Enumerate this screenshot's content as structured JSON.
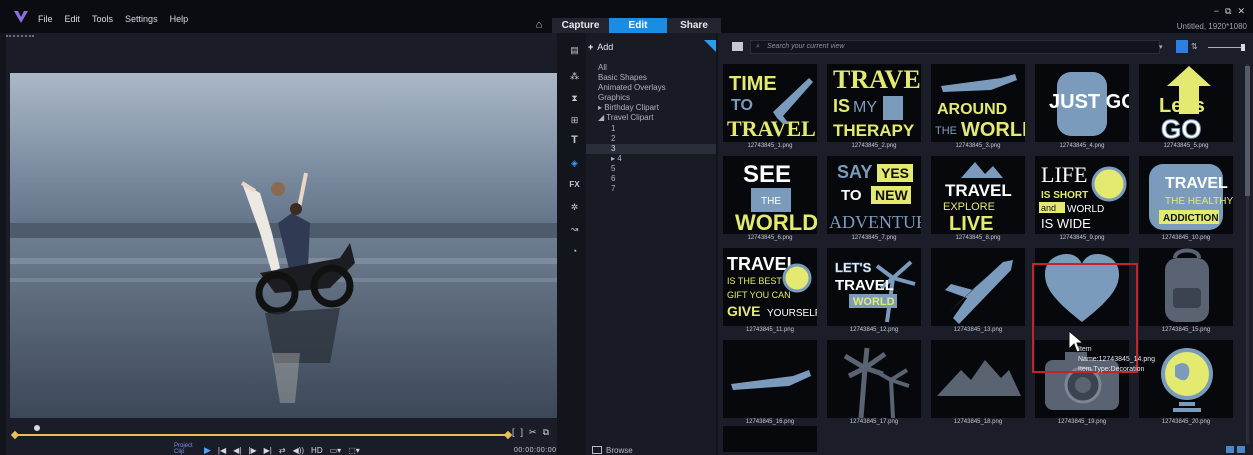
{
  "menu": {
    "items": [
      "File",
      "Edit",
      "Tools",
      "Settings",
      "Help"
    ]
  },
  "workspace_tabs": [
    "Capture",
    "Edit",
    "Share"
  ],
  "window": {
    "project_name": "Untitled, 1920*1080",
    "controls": [
      "−",
      "⧉",
      "✕"
    ]
  },
  "player": {
    "project_label": "Project",
    "clip_label": "Clip",
    "controls": [
      "▶",
      "|◀",
      "◀|",
      "|▶",
      "▶|",
      "⇄",
      "◀))",
      "HD",
      "▭▾",
      "⬚▾"
    ],
    "timecode": "00:00:00:00 ⇕",
    "trim": [
      "[",
      "]",
      "✂",
      "⧉"
    ],
    "playhead_position_fraction": 0.04
  },
  "library": {
    "add_label": "Add",
    "search_placeholder": "Search your current view",
    "browse_label": "Browse",
    "tree": [
      {
        "label": "All",
        "level": 1,
        "selected": false
      },
      {
        "label": "Basic Shapes",
        "level": 1,
        "selected": false
      },
      {
        "label": "Animated Overlays",
        "level": 1,
        "selected": false
      },
      {
        "label": "Graphics",
        "level": 1,
        "selected": false
      },
      {
        "label": "▸ Birthday Clipart",
        "level": 1,
        "selected": false
      },
      {
        "label": "◢ Travel Clipart",
        "level": 1,
        "selected": false
      },
      {
        "label": "1",
        "level": 2,
        "selected": false
      },
      {
        "label": "2",
        "level": 2,
        "selected": false
      },
      {
        "label": "3",
        "level": 2,
        "selected": true
      },
      {
        "label": "▸ 4",
        "level": 2,
        "selected": false
      },
      {
        "label": "5",
        "level": 2,
        "selected": false
      },
      {
        "label": "6",
        "level": 2,
        "selected": false
      },
      {
        "label": "7",
        "level": 2,
        "selected": false
      }
    ],
    "items": [
      {
        "file": "12743845_1.png",
        "art": "TIME TO TRAVEL"
      },
      {
        "file": "12743845_2.png",
        "art": "TRAVEL IS MY THERAPY"
      },
      {
        "file": "12743845_3.png",
        "art": "AROUND THE WORLD"
      },
      {
        "file": "12743845_4.png",
        "art": "JUST GO"
      },
      {
        "file": "12743845_5.png",
        "art": "Let's GO"
      },
      {
        "file": "12743845_6.png",
        "art": "SEE THE WORLD"
      },
      {
        "file": "12743845_7.png",
        "art": "SAY YES TO NEW ADVENTURES"
      },
      {
        "file": "12743845_8.png",
        "art": "TRAVEL EXPLORE LIVE"
      },
      {
        "file": "12743845_9.png",
        "art": "LIFE IS SHORT and WORLD IS WIDE"
      },
      {
        "file": "12743845_10.png",
        "art": "TRAVEL IS THE HEALTHY ADDICTION"
      },
      {
        "file": "12743845_11.png",
        "art": "TRAVEL IS THE BEST GIFT YOU CAN GIVE YOURSELF"
      },
      {
        "file": "12743845_12.png",
        "art": "LET'S TRAVEL THE WORLD"
      },
      {
        "file": "12743845_13.png",
        "art": ""
      },
      {
        "file": "12743845_14.png",
        "art": ""
      },
      {
        "file": "12743845_15.png",
        "art": ""
      },
      {
        "file": "12743845_16.png",
        "art": ""
      },
      {
        "file": "12743845_17.png",
        "art": ""
      },
      {
        "file": "12743845_18.png",
        "art": ""
      },
      {
        "file": "12743845_19.png",
        "art": ""
      },
      {
        "file": "12743845_20.png",
        "art": ""
      }
    ],
    "tooltip": {
      "name": "Item Name:12743845_14.png",
      "type": "Item Type:Decoration"
    }
  },
  "colors": {
    "accent": "#1a8de3",
    "clip_yellow": "#e3ea6f",
    "clip_blue": "#7b9bbd",
    "selection": "#c2242a"
  }
}
